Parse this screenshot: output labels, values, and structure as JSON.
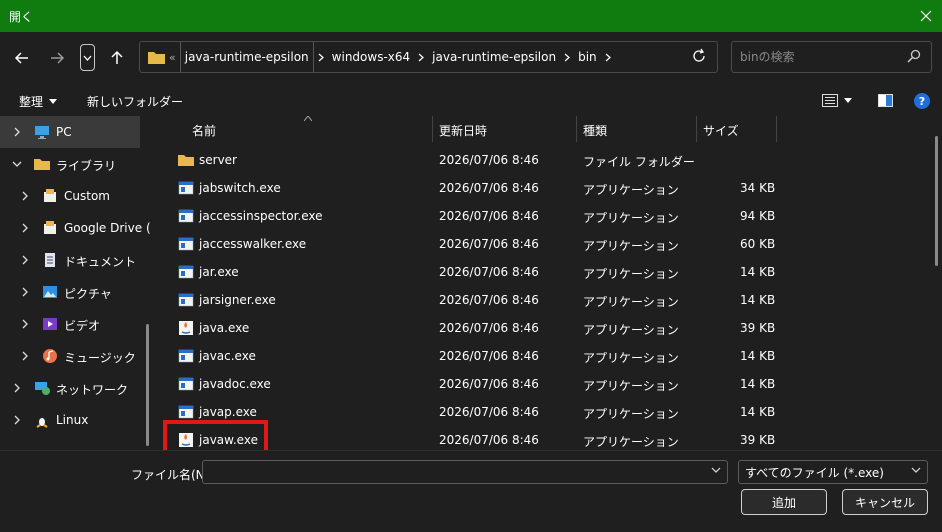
{
  "window": {
    "title": "開く"
  },
  "address": {
    "segments": [
      "java-runtime-epsilon",
      "windows-x64",
      "java-runtime-epsilon",
      "bin"
    ]
  },
  "search": {
    "placeholder": "binの検索"
  },
  "toolbar": {
    "organize": "整理",
    "new_folder": "新しいフォルダー"
  },
  "sidebar": {
    "items": [
      {
        "label": "PC",
        "icon": "pc-icon"
      },
      {
        "label": "ライブラリ",
        "icon": "library-folder-icon"
      },
      {
        "label": "Custom",
        "icon": "custom-library-icon"
      },
      {
        "label": "Google Drive (",
        "icon": "google-drive-icon"
      },
      {
        "label": "ドキュメント",
        "icon": "documents-icon"
      },
      {
        "label": "ピクチャ",
        "icon": "pictures-icon"
      },
      {
        "label": "ビデオ",
        "icon": "videos-icon"
      },
      {
        "label": "ミュージック",
        "icon": "music-icon"
      },
      {
        "label": "ネットワーク",
        "icon": "network-icon"
      },
      {
        "label": "Linux",
        "icon": "linux-icon"
      }
    ]
  },
  "columns": {
    "name": "名前",
    "date": "更新日時",
    "type": "種類",
    "size": "サイズ"
  },
  "files": [
    {
      "name": "server",
      "date": "2026/07/06 8:46",
      "type": "ファイル フォルダー",
      "size": "",
      "icon": "folder-icon"
    },
    {
      "name": "jabswitch.exe",
      "date": "2026/07/06 8:46",
      "type": "アプリケーション",
      "size": "34 KB",
      "icon": "exe-icon"
    },
    {
      "name": "jaccessinspector.exe",
      "date": "2026/07/06 8:46",
      "type": "アプリケーション",
      "size": "94 KB",
      "icon": "exe-icon"
    },
    {
      "name": "jaccesswalker.exe",
      "date": "2026/07/06 8:46",
      "type": "アプリケーション",
      "size": "60 KB",
      "icon": "exe-icon"
    },
    {
      "name": "jar.exe",
      "date": "2026/07/06 8:46",
      "type": "アプリケーション",
      "size": "14 KB",
      "icon": "exe-icon"
    },
    {
      "name": "jarsigner.exe",
      "date": "2026/07/06 8:46",
      "type": "アプリケーション",
      "size": "14 KB",
      "icon": "exe-icon"
    },
    {
      "name": "java.exe",
      "date": "2026/07/06 8:46",
      "type": "アプリケーション",
      "size": "39 KB",
      "icon": "java-icon"
    },
    {
      "name": "javac.exe",
      "date": "2026/07/06 8:46",
      "type": "アプリケーション",
      "size": "14 KB",
      "icon": "exe-icon"
    },
    {
      "name": "javadoc.exe",
      "date": "2026/07/06 8:46",
      "type": "アプリケーション",
      "size": "14 KB",
      "icon": "exe-icon"
    },
    {
      "name": "javap.exe",
      "date": "2026/07/06 8:46",
      "type": "アプリケーション",
      "size": "14 KB",
      "icon": "exe-icon"
    },
    {
      "name": "javaw.exe",
      "date": "2026/07/06 8:46",
      "type": "アプリケーション",
      "size": "39 KB",
      "icon": "java-icon"
    }
  ],
  "bottom": {
    "filename_label": "ファイル名(N):",
    "filename_value": "",
    "filter": "すべてのファイル (*.exe)",
    "add_button": "追加",
    "cancel_button": "キャンセル"
  },
  "colors": {
    "titlebar": "#107c10",
    "highlight": "#e01818",
    "background": "#1f1f1f"
  }
}
